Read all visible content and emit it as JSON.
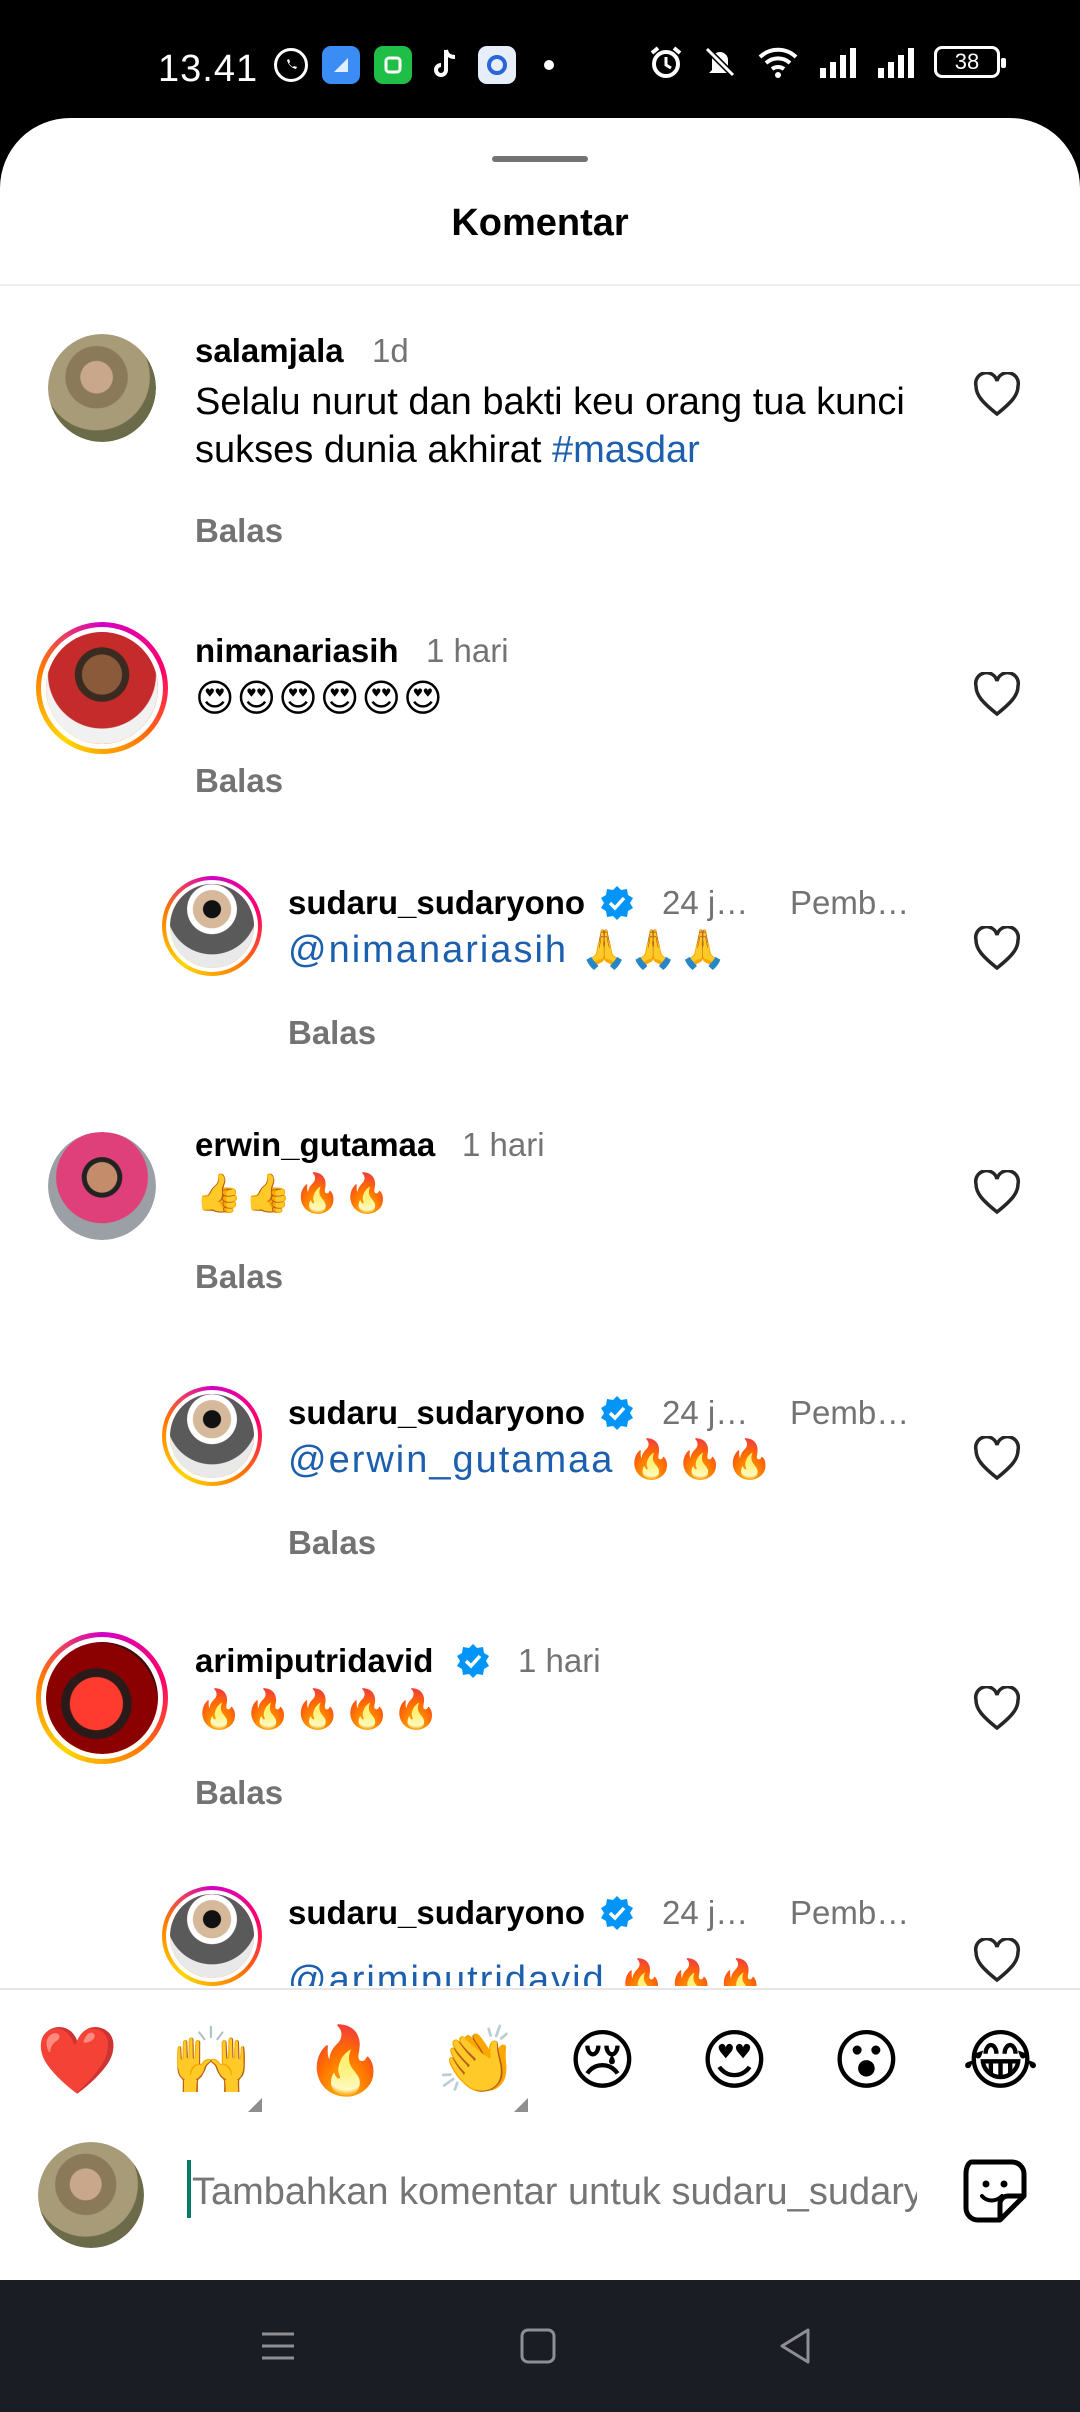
{
  "status_bar": {
    "time": "13.41",
    "app_icons": [
      "whatsapp-icon",
      "blue-app-icon",
      "green-app-icon",
      "tiktok-icon",
      "db-app-icon"
    ],
    "system_icons": [
      "alarm-icon",
      "mute-icon",
      "wifi-icon",
      "signal-icon",
      "signal-icon"
    ],
    "battery": "38"
  },
  "sheet": {
    "title": "Komentar"
  },
  "comments": [
    {
      "username": "salamjala",
      "time": "1d",
      "text_plain": "Selalu nurut dan bakti keu orang tua kunci sukses dunia akhirat ",
      "hashtag": "#masdar",
      "reply": "Balas"
    },
    {
      "username": "nimanariasih",
      "time": "1 hari",
      "emojis": "😍😍😍😍😍😍",
      "reply": "Balas"
    },
    {
      "username": "sudaru_sudaryono",
      "verified": true,
      "time": "24 j…",
      "pinned": "Pemb…",
      "mention": "@nimanariasih",
      "emojis": " 🙏🙏🙏",
      "reply": "Balas"
    },
    {
      "username": "erwin_gutamaa",
      "time": "1 hari",
      "emojis": "👍👍🔥🔥",
      "reply": "Balas"
    },
    {
      "username": "sudaru_sudaryono",
      "verified": true,
      "time": "24 j…",
      "pinned": "Pemb…",
      "mention": "@erwin_gutamaa",
      "emojis": " 🔥🔥🔥",
      "reply": "Balas"
    },
    {
      "username": "arimiputridavid",
      "verified": true,
      "time": "1 hari",
      "emojis": "🔥🔥🔥🔥🔥",
      "reply": "Balas"
    },
    {
      "username": "sudaru_sudaryono",
      "verified": true,
      "time": "24 j…",
      "pinned": "Pemb…",
      "mention": "@arimiputridavid",
      "emojis": " 🔥🔥🔥"
    }
  ],
  "reactions": [
    "❤️",
    "🙌",
    "🔥",
    "👏",
    "😢",
    "😍",
    "😮",
    "😂"
  ],
  "composer": {
    "placeholder": "Tambahkan komentar untuk sudaru_sudaryono..."
  },
  "colors": {
    "link": "#1c5fae",
    "secondary_text": "#737373",
    "verified": "#0095f6"
  }
}
